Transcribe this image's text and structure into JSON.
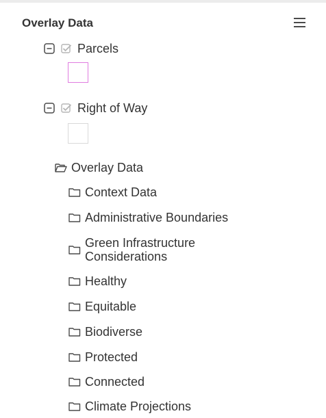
{
  "panel": {
    "title": "Overlay Data",
    "menu_icon": "hamburger-menu-icon"
  },
  "layers": [
    {
      "label": "Parcels",
      "checked": true,
      "collapse_icon": "minus-box-icon",
      "check_icon": "checkbox-checked-icon",
      "swatch_fill": "#ffffff",
      "swatch_border": "#e07ce0"
    },
    {
      "label": "Right of Way",
      "checked": true,
      "collapse_icon": "minus-box-icon",
      "check_icon": "checkbox-checked-icon",
      "swatch_fill": "#ffffff",
      "swatch_border": "#d9d9d9"
    }
  ],
  "group": {
    "label": "Overlay Data",
    "icon": "folder-open-icon",
    "folders": [
      {
        "label": "Context Data",
        "icon": "folder-icon"
      },
      {
        "label": "Administrative Boundaries",
        "icon": "folder-icon"
      },
      {
        "label": "Green Infrastructure Considerations",
        "icon": "folder-icon"
      },
      {
        "label": "Healthy",
        "icon": "folder-icon"
      },
      {
        "label": "Equitable",
        "icon": "folder-icon"
      },
      {
        "label": "Biodiverse",
        "icon": "folder-icon"
      },
      {
        "label": "Protected",
        "icon": "folder-icon"
      },
      {
        "label": "Connected",
        "icon": "folder-icon"
      },
      {
        "label": "Climate Projections",
        "icon": "folder-icon"
      }
    ]
  },
  "colors": {
    "text": "#333333",
    "icon": "#4a4a4a",
    "check": "#b5b5b5"
  }
}
